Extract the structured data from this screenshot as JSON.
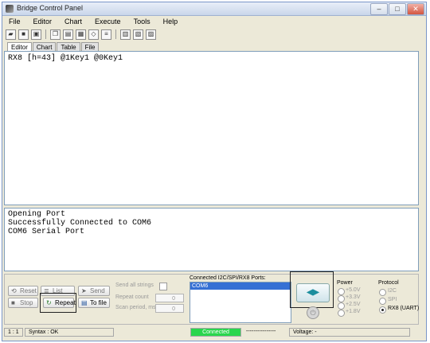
{
  "window": {
    "title": "Bridge Control Panel"
  },
  "menu": [
    "File",
    "Editor",
    "Chart",
    "Execute",
    "Tools",
    "Help"
  ],
  "window_buttons": {
    "minimize": "–",
    "maximize": "□",
    "close": "✕"
  },
  "tabs": [
    "Editor",
    "Chart",
    "Table",
    "File"
  ],
  "editor": {
    "text": "RX8 [h=43] @1Key1 @0Key1"
  },
  "output": {
    "lines": [
      "Opening Port",
      "Successfully Connected to COM6",
      "COM6 Serial Port"
    ]
  },
  "controls": {
    "reset": "Reset",
    "list": "List",
    "send": "Send",
    "stop": "Stop",
    "repeat": "Repeat",
    "to_file": "To file",
    "send_all_strings": "Send all strings",
    "repeat_count": "Repeat count",
    "repeat_count_value": "0",
    "scan_period": "Scan period, ms",
    "scan_period_value": "0"
  },
  "ports": {
    "label": "Connected I2C/SPI/RX8 Ports:",
    "items": [
      "COM6"
    ]
  },
  "power": {
    "label": "Power",
    "options": [
      "+5.0V",
      "+3.3V",
      "+2.5V",
      "+1.8V"
    ]
  },
  "protocol": {
    "label": "Protocol",
    "options": [
      "I2C",
      "SPI",
      "RX8 (UART)"
    ],
    "selected": "RX8 (UART)"
  },
  "status": {
    "position": "1 : 1",
    "syntax": "Syntax : OK",
    "connection": "Connected",
    "dashes": "----------------",
    "voltage": "Voltage: -"
  }
}
